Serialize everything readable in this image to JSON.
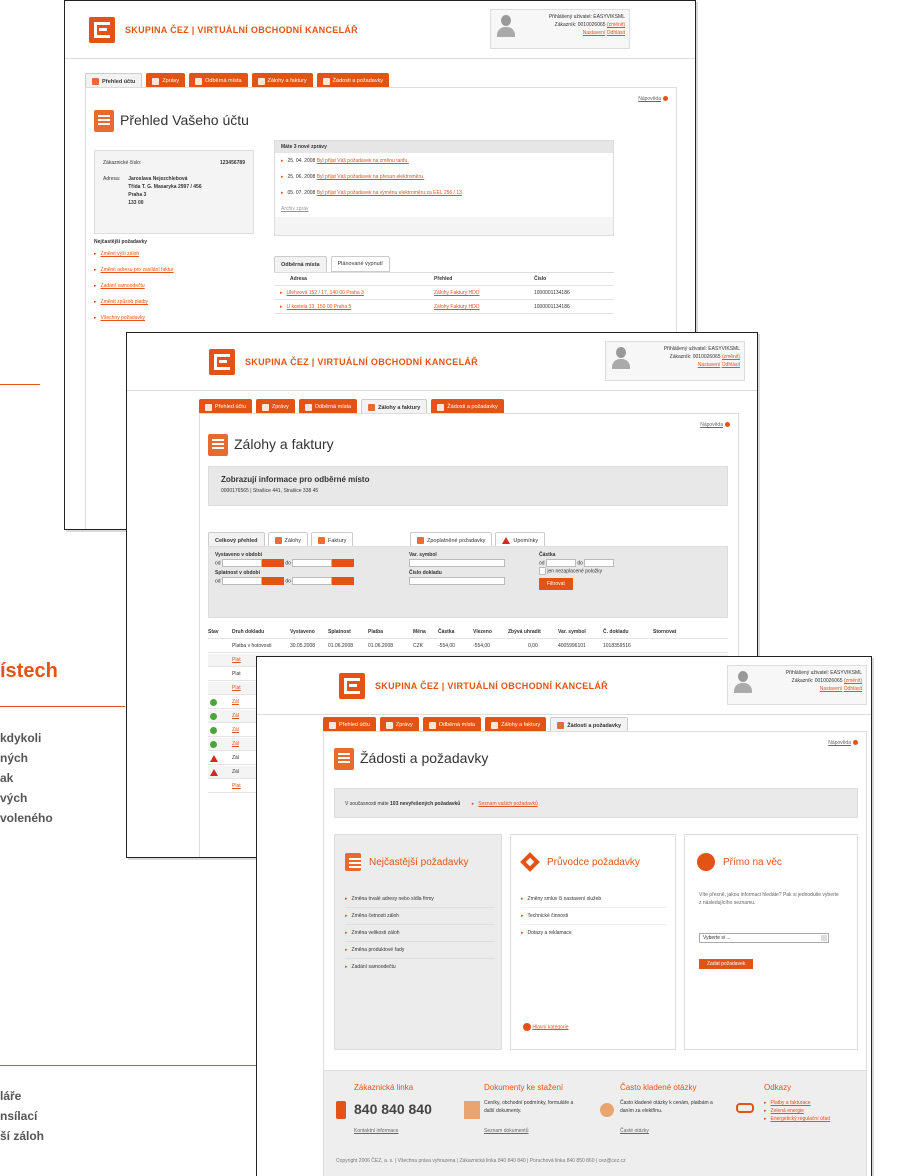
{
  "brand": "SKUPINA ČEZ | VIRTUÁLNÍ OBCHODNÍ KANCELÁŘ",
  "user": {
    "logged_in": "Přihlášený uživatel: EASYVIKSML",
    "customer_label": "Zákazník:",
    "customer_number": "0010026065",
    "change": "(změnit)",
    "links": [
      "Nastavení",
      "Odhlásit"
    ]
  },
  "help": "Nápověda",
  "side_fragments": {
    "heading": "ístech",
    "lines1": [
      "kdykoli",
      "ných",
      "ak",
      "vých",
      "voleného"
    ],
    "lines2": [
      "láře",
      "nsílací",
      "ší záloh"
    ]
  },
  "s1": {
    "tabs": [
      "Přehled účtu",
      "Zprávy",
      "Odběrná místa",
      "Zálohy a faktury",
      "Žádosti a požadavky"
    ],
    "title": "Přehled Vašeho účtu",
    "customer_no_label": "Zákaznické číslo:",
    "customer_no": "123456789",
    "address_label": "Adresa:",
    "address_lines": [
      "Jaroslava Nejezchlebová",
      "Třída T. G. Masaryka 2997 / 456",
      "Praha 3",
      "133 00"
    ],
    "frequent_title": "Nejčastější požadavky",
    "frequent": [
      "Změnit výši záloh",
      "Změnit adresu pro zasílání faktur",
      "Zadání samoodečtu",
      "Změnit způsob platby",
      "Všechny požadavky"
    ],
    "news_title": "Máte 3 nové zprávy",
    "news": [
      {
        "date": "25. 04. 2008",
        "text": "Byl přijat Váš požadavek na změnu tarifu."
      },
      {
        "date": "25. 06. 2008",
        "text": "Byl přijat Váš požadavek na přesun elektroměru."
      },
      {
        "date": "05. 07. 2008",
        "text": "Byl přijat Váš požadavek na výměnu elektroměru za EEL 256 / 13"
      }
    ],
    "archive": "Archiv zpráv",
    "om_tabs": [
      "Odběrná místa",
      "Plánované vypnutí"
    ],
    "om_headers": [
      "Adresa",
      "Přehled",
      "Číslo"
    ],
    "om_rows": [
      {
        "addr": "Ulehvová 152 / 17, 140 00 Praha 3",
        "links": "Zálohy  Faktury  HDO",
        "num": "1000001134186"
      },
      {
        "addr": "U kostela 13, 150 00 Praha 5",
        "links": "Zálohy  Faktury  HDO",
        "num": "1000001134186"
      }
    ]
  },
  "s2": {
    "tabs": [
      "Přehled účtu",
      "Zprávy",
      "Odběrná místa",
      "Zálohy a faktury",
      "Žádosti a požadavky"
    ],
    "title": "Zálohy a faktury",
    "info_title": "Zobrazují informace pro odběrné místo",
    "info_sub": "0000176565 | Strašice 441, Strašice 338 45",
    "subtabs": [
      "Celkový přehled",
      "Zálohy",
      "Faktury"
    ],
    "subtabs2": [
      "Zpoplatněné požadavky",
      "Upomínky"
    ],
    "filters": {
      "issued": "Vystaveno v období",
      "due": "Splatnost v období",
      "from": "od",
      "to": "do",
      "var_symbol": "Var. symbol",
      "doc_no": "Číslo dokladu",
      "amount": "Částka",
      "unpaid": "jen nezaplacené položky",
      "filter_btn": "Filtrovat"
    },
    "table_headers": [
      "Stav",
      "Druh dokladu",
      "Vystaveno",
      "Splatnost",
      "Platba",
      "Měna",
      "Částka",
      "Vlezeno",
      "Zbývá uhradit",
      "Var. symbol",
      "Č. dokladu",
      "Stornovat"
    ],
    "first_row": [
      "Platba v hotovosti",
      "30.05.2008",
      "01.06.2008",
      "01.06.2008",
      "CZK",
      "-554,00",
      "-554,00",
      "0,00",
      "4005996101",
      "1018359516"
    ],
    "row_labels": [
      "Plat",
      "Plat",
      "Plat",
      "Zál",
      "Zál",
      "Zál",
      "Zál",
      "Zál",
      "Zál",
      "Plat"
    ]
  },
  "s3": {
    "tabs": [
      "Přehled účtu",
      "Zprávy",
      "Odběrná místa",
      "Zálohy a faktury",
      "Žádosti a požadavky"
    ],
    "title": "Žádosti a požadavky",
    "status_prefix": "V současnosti máte",
    "status_count": "103 nevyřešených požadavků",
    "status_link": "Seznam vašich požadavků",
    "card1_title": "Nejčastější požadavky",
    "card1_items": [
      "Změna trvalé adresy nebo sídla firmy",
      "Změna četnosti záloh",
      "Změna velikosti záloh",
      "Změna produktové řady",
      "Zadání samoodečtu"
    ],
    "card2_title": "Průvodce požadavky",
    "card2_items": [
      "Změny smluv či nastavení služeb",
      "Technické činnosti",
      "Dotazy a reklamace"
    ],
    "card2_link": "Hlavní kategorie",
    "card3_title": "Přímo na věc",
    "card3_text": "Víte přesně, jakou informaci hledáte? Pak si jednoduše vyberte z následujícího seznamu.",
    "card3_select": "Vyberte si ...",
    "card3_btn": "Zadat požadavek",
    "footer": {
      "phone_title": "Zákaznická linka",
      "phone": "840 840 840",
      "phone_link": "Kontaktní informace",
      "docs_title": "Dokumenty ke stažení",
      "docs_text": "Ceníky, obchodní podmínky, formuláře a další dokumenty.",
      "docs_link": "Seznam dokumentů",
      "faq_title": "Často kladené otázky",
      "faq_text": "Často kladené otázky k cenám, platbám a daním za elektřinu.",
      "faq_link": "Časté otázky",
      "links_title": "Odkazy",
      "links": [
        "Platby a fakturace",
        "Zelená energie",
        "Energetický regulační úřad"
      ],
      "copyright": "Copyright 2006 ČEZ, a. s.  |  Všechna práva vyhrazena  |  Zákaznická linka 840 840 840  |  Poruchová linka 840 850 860  |  cez@cez.cz"
    }
  }
}
